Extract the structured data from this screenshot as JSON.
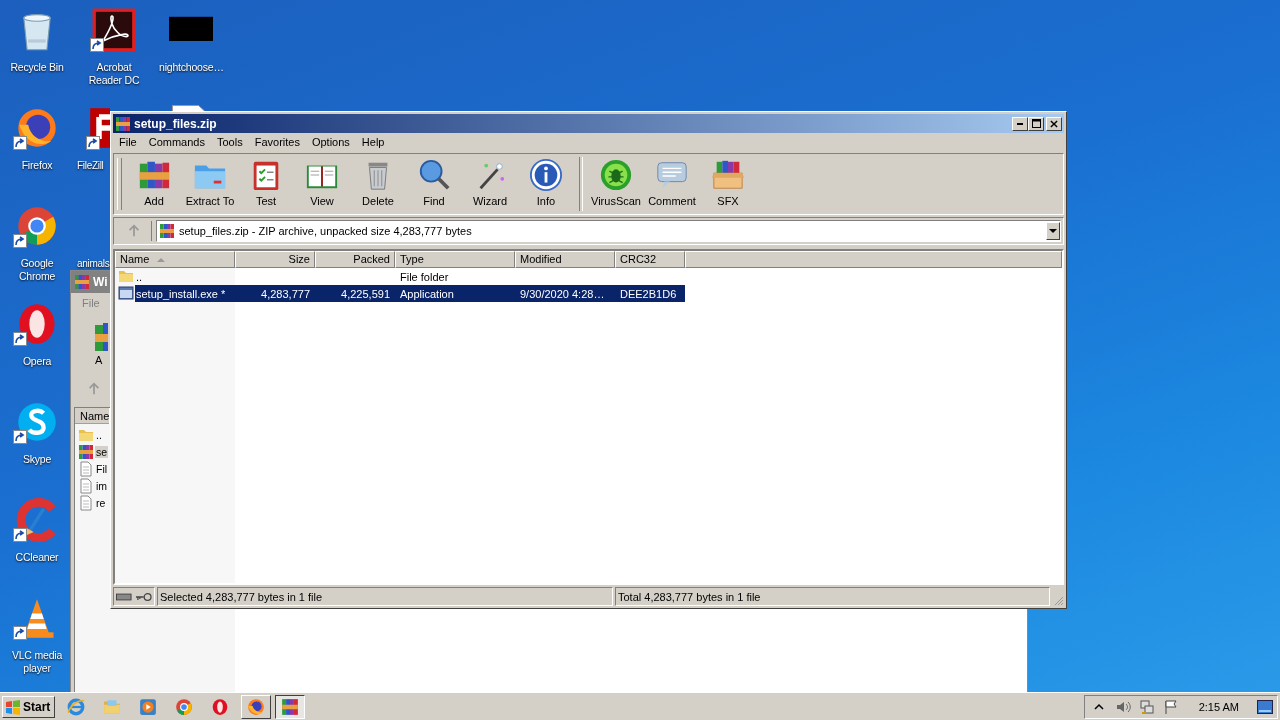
{
  "desktop": {
    "columns": [
      {
        "icons": [
          {
            "label": "Recycle Bin",
            "kind": "recycle"
          },
          {
            "label": "Firefox",
            "kind": "firefox",
            "shortcut": true
          },
          {
            "label": "Google Chrome",
            "kind": "chrome",
            "shortcut": true
          },
          {
            "label": "Opera",
            "kind": "opera",
            "shortcut": true
          },
          {
            "label": "Skype",
            "kind": "skype",
            "shortcut": true
          },
          {
            "label": "CCleaner",
            "kind": "ccleaner",
            "shortcut": true
          },
          {
            "label": "VLC media player",
            "kind": "vlc",
            "shortcut": true
          }
        ]
      },
      {
        "icons": [
          {
            "label": "Acrobat Reader DC",
            "kind": "acrobat",
            "shortcut": true
          },
          {
            "label": "FileZill",
            "kind": "filezilla",
            "shortcut": true
          },
          {
            "label": "animals",
            "kind": "hidden"
          }
        ]
      },
      {
        "icons": [
          {
            "label": "nightchoose…",
            "kind": "black"
          },
          {
            "kind": "doc-top"
          }
        ]
      }
    ]
  },
  "background_window": {
    "title": "Wi",
    "menu": [
      "File"
    ],
    "toolbar": [
      "A"
    ],
    "column": "Name",
    "rows": [
      {
        "name": "..",
        "kind": "folder",
        "selected": false
      },
      {
        "name": "se",
        "kind": "archive",
        "selected": true
      },
      {
        "name": "Fil",
        "kind": "doc",
        "selected": false
      },
      {
        "name": "im",
        "kind": "doc",
        "selected": false
      },
      {
        "name": "re",
        "kind": "doc",
        "selected": false
      }
    ]
  },
  "window": {
    "title": "setup_files.zip",
    "menu": [
      "File",
      "Commands",
      "Tools",
      "Favorites",
      "Options",
      "Help"
    ],
    "toolbar": [
      {
        "buttons": [
          {
            "label": "Add",
            "kind": "add"
          },
          {
            "label": "Extract To",
            "kind": "extract"
          },
          {
            "label": "Test",
            "kind": "test"
          },
          {
            "label": "View",
            "kind": "view"
          },
          {
            "label": "Delete",
            "kind": "delete"
          },
          {
            "label": "Find",
            "kind": "find"
          },
          {
            "label": "Wizard",
            "kind": "wizard"
          },
          {
            "label": "Info",
            "kind": "info"
          }
        ]
      },
      {
        "buttons": [
          {
            "label": "VirusScan",
            "kind": "virusscan"
          },
          {
            "label": "Comment",
            "kind": "comment"
          },
          {
            "label": "SFX",
            "kind": "sfx"
          }
        ]
      }
    ],
    "address": "setup_files.zip - ZIP archive, unpacked size 4,283,777 bytes",
    "columns": [
      {
        "label": "Name",
        "sorted": true
      },
      {
        "label": "Size",
        "sorted": false
      },
      {
        "label": "Packed",
        "sorted": false
      },
      {
        "label": "Type",
        "sorted": false
      },
      {
        "label": "Modified",
        "sorted": false
      },
      {
        "label": "CRC32",
        "sorted": false
      }
    ],
    "rows": [
      {
        "name": "..",
        "kind": "folder",
        "type": "File folder",
        "selected": false
      },
      {
        "name": "setup_install.exe *",
        "kind": "exe",
        "size": "4,283,777",
        "packed": "4,225,591",
        "type": "Application",
        "modified": "9/30/2020 4:28…",
        "crc32": "DEE2B1D6",
        "selected": true
      }
    ],
    "status": [
      "Selected 4,283,777 bytes in 1 file",
      "Total 4,283,777 bytes in 1 file"
    ]
  },
  "taskbar": {
    "start": "Start",
    "quick_launch": [
      {
        "kind": "ie"
      },
      {
        "kind": "explorer"
      },
      {
        "kind": "media"
      },
      {
        "kind": "chrome"
      },
      {
        "kind": "opera"
      }
    ],
    "tasks": [
      {
        "kind": "firefox",
        "selected": false
      },
      {
        "kind": "winrar",
        "selected": true
      }
    ],
    "tray": [
      {
        "kind": "chevron"
      },
      {
        "kind": "speaker"
      },
      {
        "kind": "network"
      },
      {
        "kind": "flag"
      }
    ],
    "clock": "2:15 AM"
  }
}
